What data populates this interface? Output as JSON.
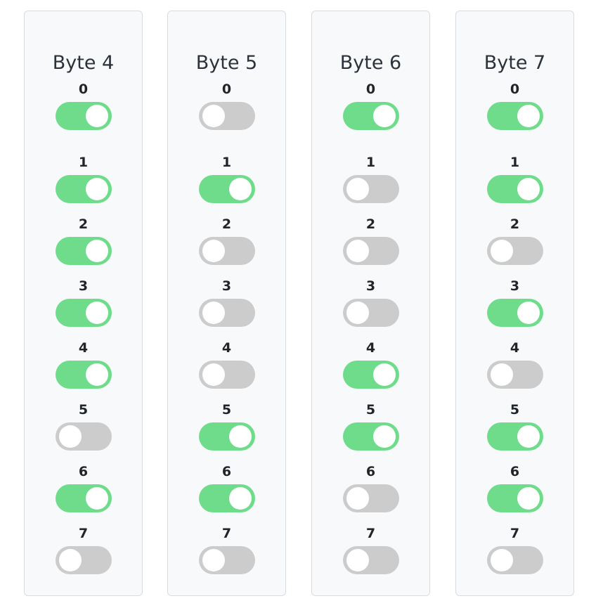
{
  "colors": {
    "toggle_on": "#6edc8a",
    "toggle_off": "#cccccc",
    "card_background": "#f8f9fb",
    "card_border": "#d9dcdf"
  },
  "bytes": [
    {
      "title": "Byte 4",
      "bits": [
        {
          "label": "0",
          "on": true
        },
        {
          "label": "1",
          "on": true
        },
        {
          "label": "2",
          "on": true
        },
        {
          "label": "3",
          "on": true
        },
        {
          "label": "4",
          "on": true
        },
        {
          "label": "5",
          "on": false
        },
        {
          "label": "6",
          "on": true
        },
        {
          "label": "7",
          "on": false
        }
      ]
    },
    {
      "title": "Byte 5",
      "bits": [
        {
          "label": "0",
          "on": false
        },
        {
          "label": "1",
          "on": true
        },
        {
          "label": "2",
          "on": false
        },
        {
          "label": "3",
          "on": false
        },
        {
          "label": "4",
          "on": false
        },
        {
          "label": "5",
          "on": true
        },
        {
          "label": "6",
          "on": true
        },
        {
          "label": "7",
          "on": false
        }
      ]
    },
    {
      "title": "Byte 6",
      "bits": [
        {
          "label": "0",
          "on": true
        },
        {
          "label": "1",
          "on": false
        },
        {
          "label": "2",
          "on": false
        },
        {
          "label": "3",
          "on": false
        },
        {
          "label": "4",
          "on": true
        },
        {
          "label": "5",
          "on": true
        },
        {
          "label": "6",
          "on": false
        },
        {
          "label": "7",
          "on": false
        }
      ]
    },
    {
      "title": "Byte 7",
      "bits": [
        {
          "label": "0",
          "on": true
        },
        {
          "label": "1",
          "on": true
        },
        {
          "label": "2",
          "on": false
        },
        {
          "label": "3",
          "on": true
        },
        {
          "label": "4",
          "on": false
        },
        {
          "label": "5",
          "on": true
        },
        {
          "label": "6",
          "on": true
        },
        {
          "label": "7",
          "on": false
        }
      ]
    }
  ]
}
